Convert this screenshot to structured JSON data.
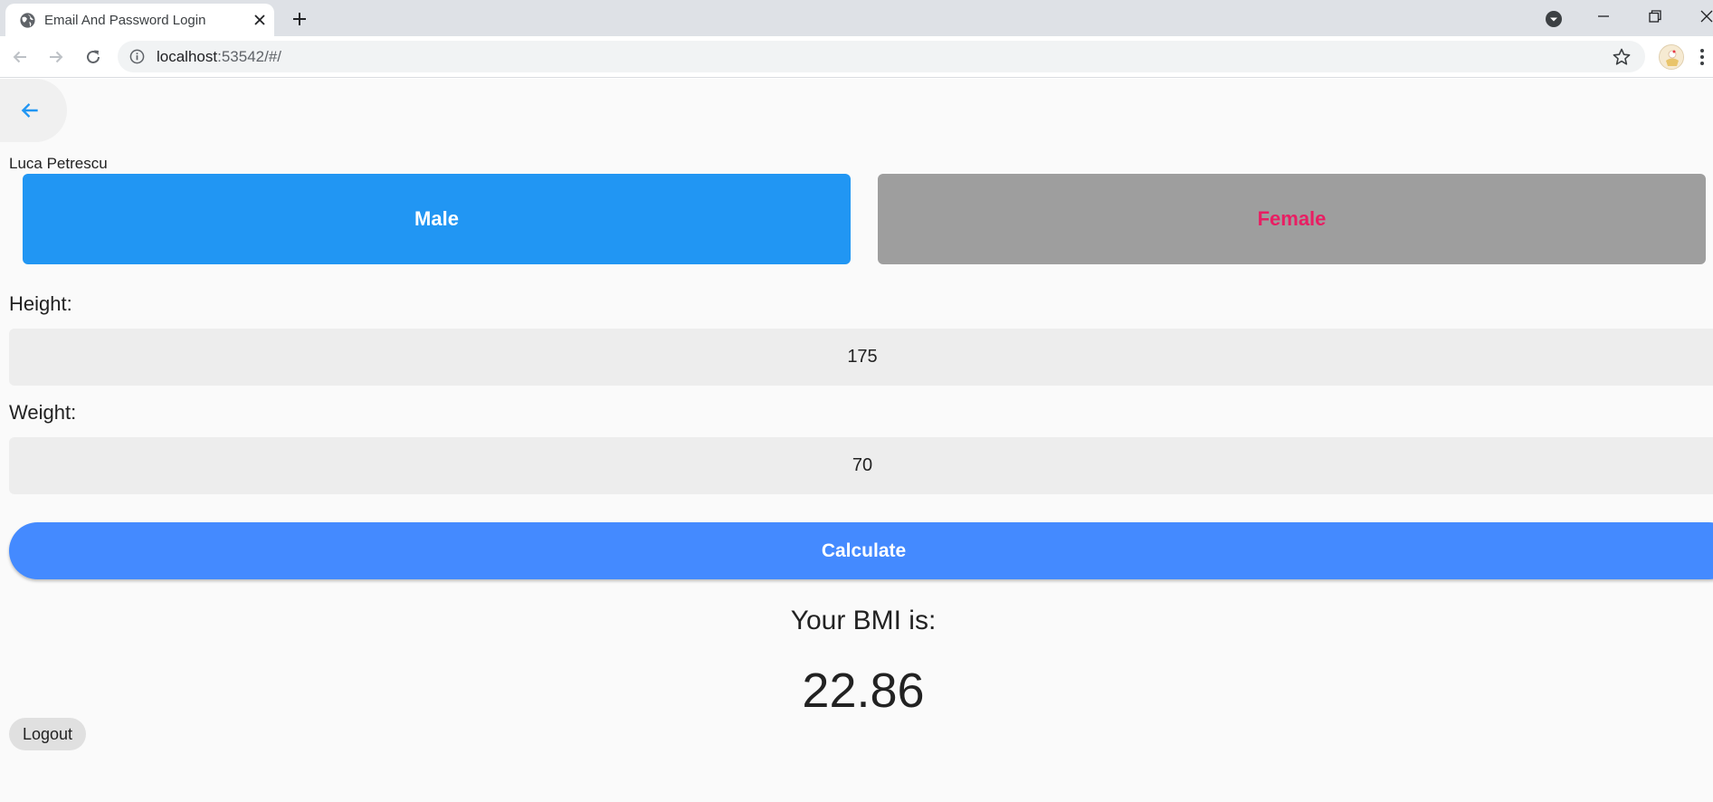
{
  "browser": {
    "tab_title": "Email And Password Login",
    "url_host": "localhost",
    "url_rest": ":53542/#/"
  },
  "app": {
    "user_name": "Luca Petrescu",
    "gender": {
      "male_label": "Male",
      "female_label": "Female",
      "selected": "Male"
    },
    "height": {
      "label": "Height:",
      "value": "175"
    },
    "weight": {
      "label": "Weight:",
      "value": "70"
    },
    "calculate_label": "Calculate",
    "result": {
      "heading": "Your BMI is:",
      "value": "22.86"
    },
    "logout_label": "Logout"
  },
  "colors": {
    "male_button": "#2196f3",
    "female_button": "#9e9e9e",
    "female_text": "#e91e63",
    "calculate_button": "#448aff",
    "page_background": "#fafafa"
  }
}
